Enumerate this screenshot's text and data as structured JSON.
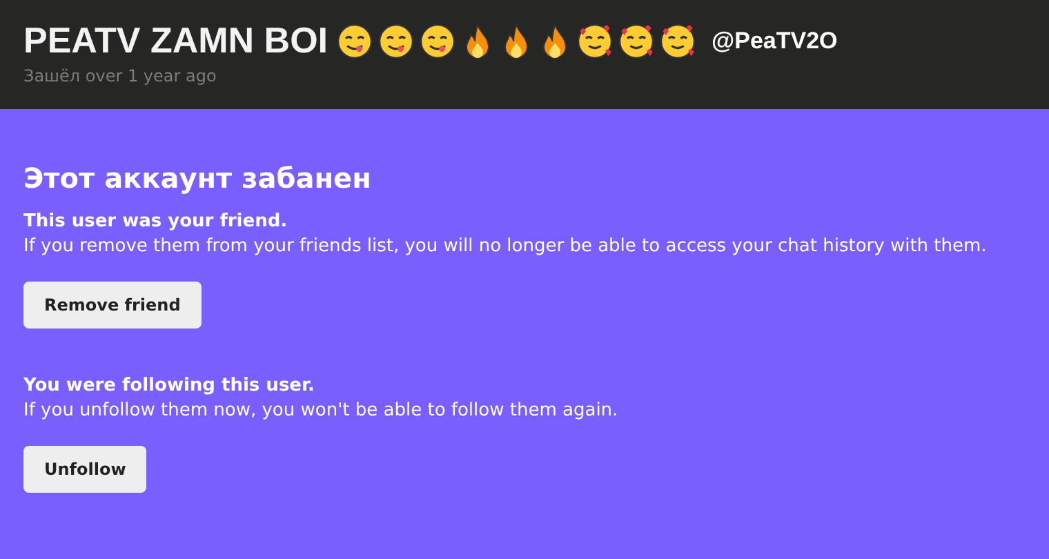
{
  "header": {
    "display_name": "PEATV ZAMN BOI",
    "emojis": [
      {
        "kind": "yum"
      },
      {
        "kind": "yum"
      },
      {
        "kind": "yum"
      },
      {
        "kind": "fire"
      },
      {
        "kind": "fire"
      },
      {
        "kind": "fire"
      },
      {
        "kind": "hearts"
      },
      {
        "kind": "hearts"
      },
      {
        "kind": "hearts"
      }
    ],
    "username": "@PeaTV2O",
    "last_seen": "Зашёл over 1 year ago"
  },
  "banned_notice": {
    "title": "Этот аккаунт забанен",
    "sections": [
      {
        "heading": "This user was your friend.",
        "text": "If you remove them from your friends list, you will no longer be able to access your chat history with them.",
        "button": "Remove friend"
      },
      {
        "heading": "You were following this user.",
        "text": "If you unfollow them now, you won't be able to follow them again.",
        "button": "Unfollow"
      }
    ]
  }
}
